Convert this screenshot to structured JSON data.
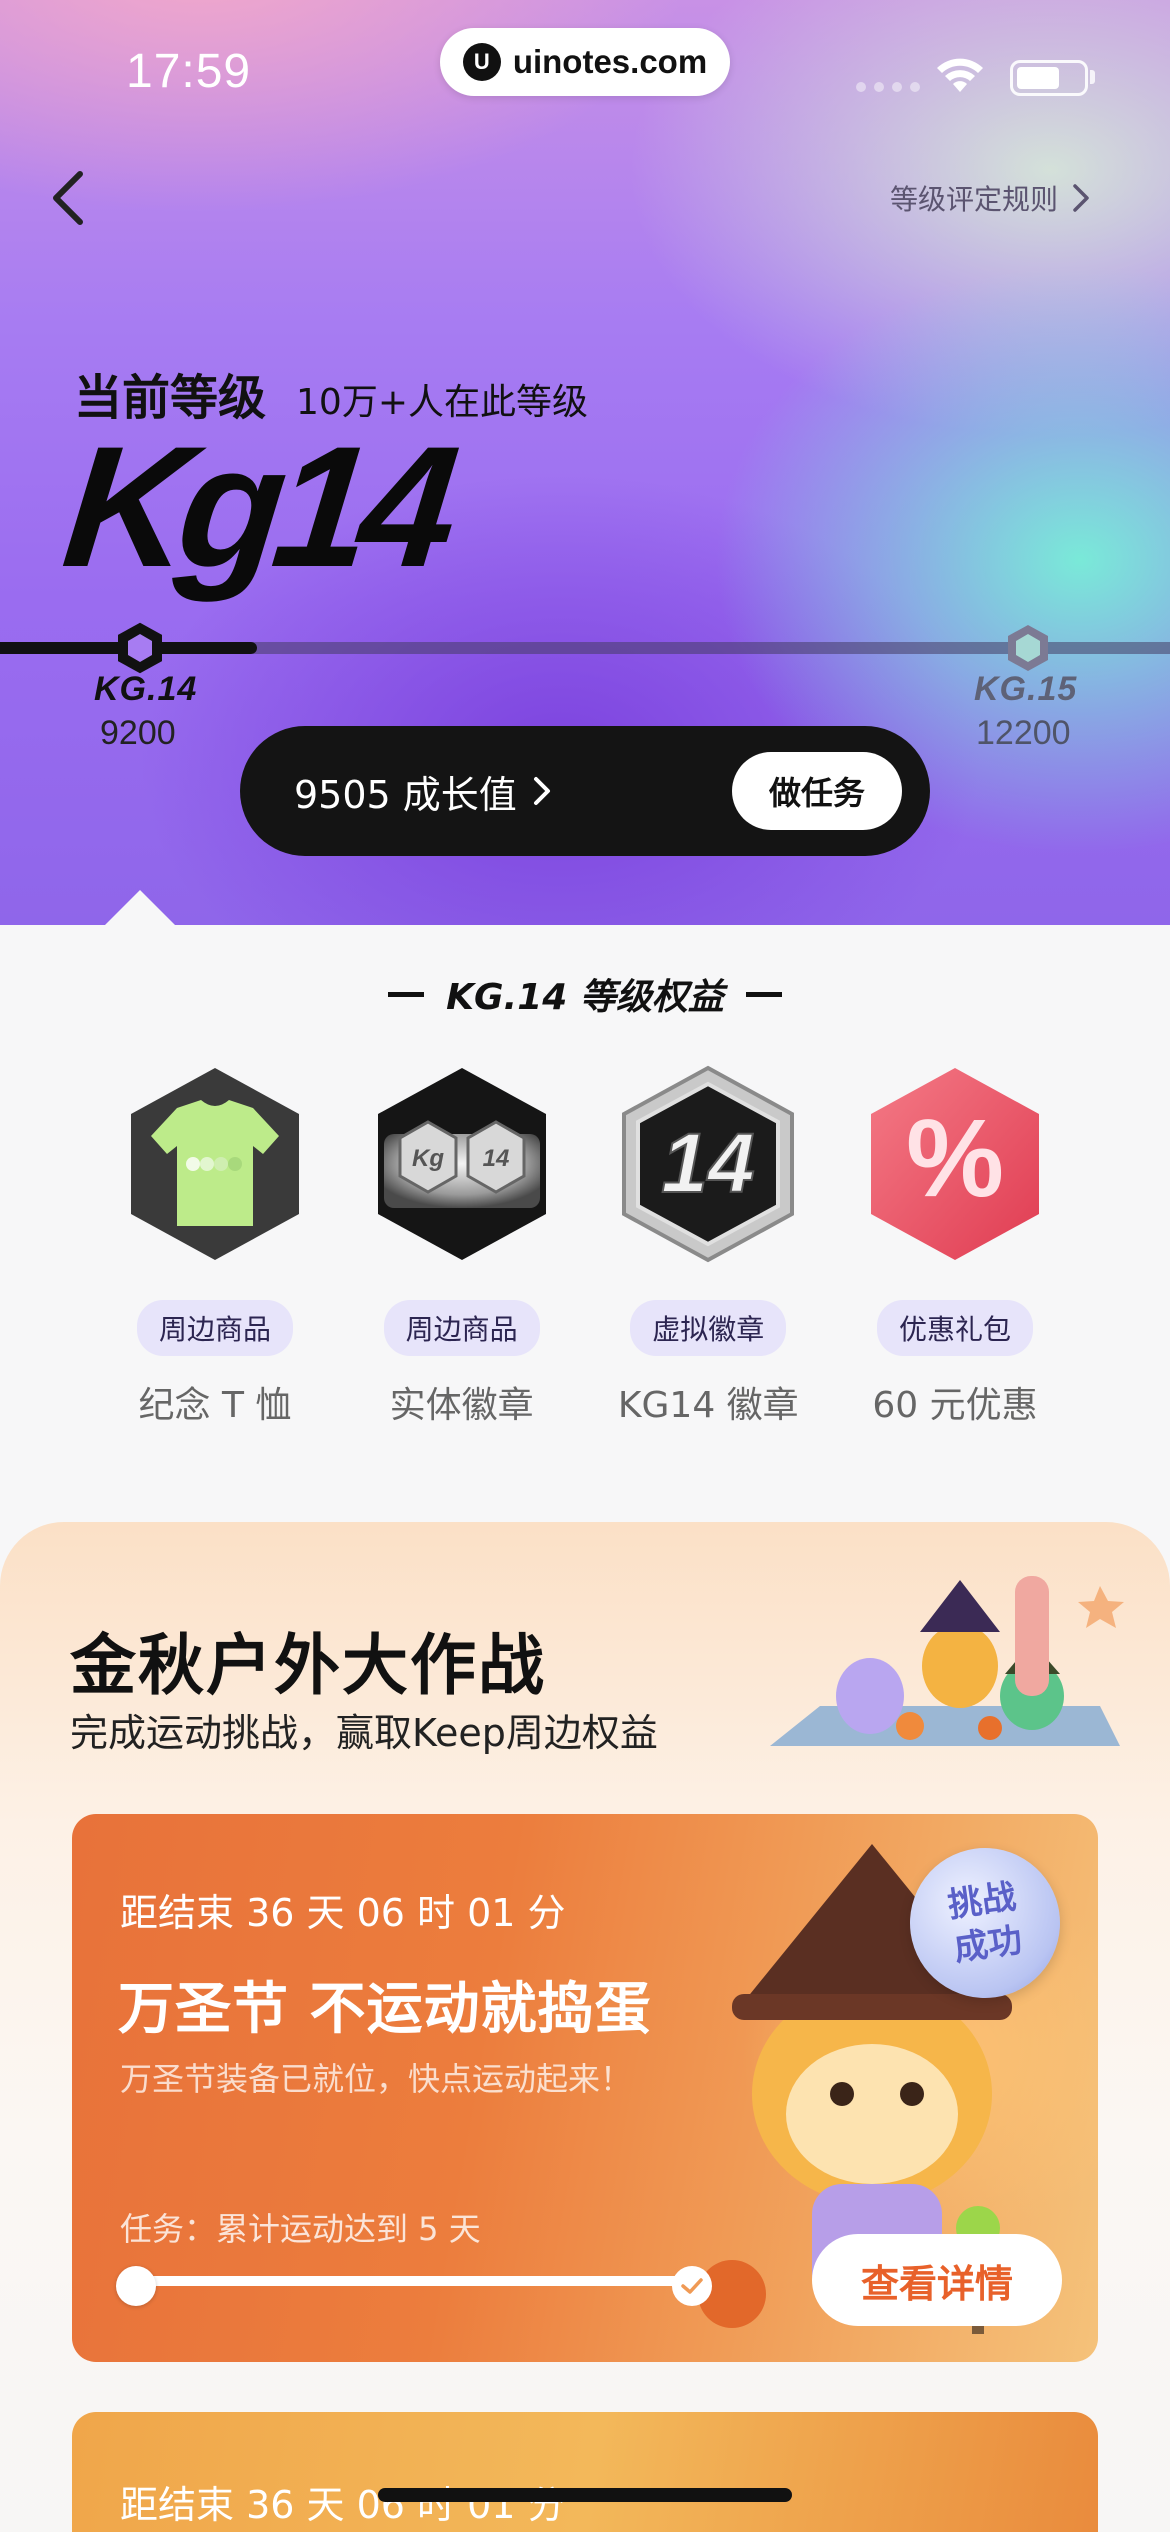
{
  "status_bar": {
    "time": "17:59",
    "url": "uinotes.com",
    "url_logo": "U"
  },
  "header": {
    "rules_link": "等级评定规则"
  },
  "level": {
    "title": "当前等级",
    "count": "10万+人在此等级",
    "big_label": "Kg14",
    "current_label": "KG.14",
    "current_value": "9200",
    "next_label": "KG.15",
    "next_value": "12200",
    "progress": 0.22
  },
  "growth": {
    "value_text": "9505 成长值",
    "task_button": "做任务"
  },
  "benefits": {
    "title": "KG.14 等级权益",
    "items": [
      {
        "tag": "周边商品",
        "name": "纪念 T 恤",
        "icon": "tshirt-icon"
      },
      {
        "tag": "周边商品",
        "name": "实体徽章",
        "icon": "physical-badge-icon"
      },
      {
        "tag": "虚拟徽章",
        "name": "KG14 徽章",
        "icon": "kg14-badge-icon",
        "badge_text": "14"
      },
      {
        "tag": "优惠礼包",
        "name": "60 元优惠",
        "icon": "discount-icon",
        "badge_text": "%"
      }
    ]
  },
  "event": {
    "title": "金秋户外大作战",
    "subtitle": "完成运动挑战，赢取Keep周边权益",
    "cards": [
      {
        "countdown": "距结束 36 天 06 时 01 分",
        "title": "万圣节 不运动就捣蛋",
        "desc": "万圣节装备已就位，快点运动起来！",
        "task": "任务：累计运动达到 5 天",
        "badge": "挑战成功",
        "badge_line1": "挑战",
        "badge_line2": "成功",
        "button": "查看详情",
        "progress": 1.0
      },
      {
        "countdown": "距结束 36 天 06 时 01 分"
      }
    ]
  },
  "colors": {
    "accent_orange": "#e8612a",
    "tag_bg": "#e7e4fa",
    "dark": "#141414"
  }
}
